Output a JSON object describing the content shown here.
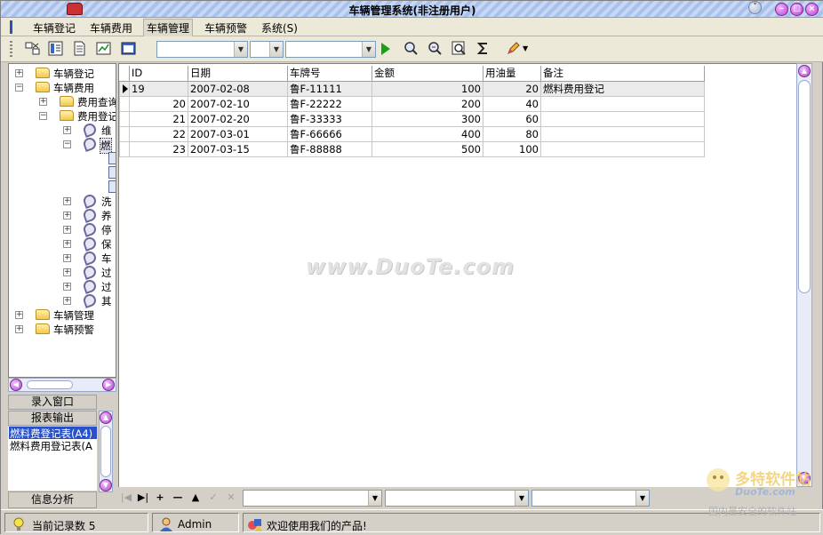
{
  "window": {
    "title": "车辆管理系统(非注册用户)"
  },
  "menu": {
    "items": [
      "车辆登记",
      "车辆费用",
      "车辆管理",
      "车辆预警",
      "系统(S)"
    ]
  },
  "toolbar": {
    "combo1": "",
    "combo2": "",
    "combo3": ""
  },
  "tree": {
    "nodes": [
      {
        "label": "车辆登记"
      },
      {
        "label": "车辆费用"
      },
      {
        "label": "费用查询"
      },
      {
        "label": "费用登记"
      },
      {
        "label": "维"
      },
      {
        "label": "燃"
      },
      {
        "label": "洗"
      },
      {
        "label": "养"
      },
      {
        "label": "停"
      },
      {
        "label": "保"
      },
      {
        "label": "车"
      },
      {
        "label": "过"
      },
      {
        "label": "过"
      },
      {
        "label": "其"
      },
      {
        "label": "车辆管理"
      },
      {
        "label": "车辆预警"
      }
    ]
  },
  "left_sections": {
    "entry_window": "录入窗口",
    "report_output": "报表输出",
    "reports": [
      "燃料费登记表(A4)",
      "燃料费用登记表(A"
    ],
    "analysis": "信息分析"
  },
  "grid": {
    "columns": [
      "ID",
      "日期",
      "车牌号",
      "金额",
      "用油量",
      "备注"
    ],
    "rows": [
      {
        "id": "19",
        "date": "2007-02-08",
        "plate": "鲁F-11111",
        "amount": "100",
        "fuel": "20",
        "note": "燃料费用登记"
      },
      {
        "id": "20",
        "date": "2007-02-10",
        "plate": "鲁F-22222",
        "amount": "200",
        "fuel": "40",
        "note": ""
      },
      {
        "id": "21",
        "date": "2007-02-20",
        "plate": "鲁F-33333",
        "amount": "300",
        "fuel": "60",
        "note": ""
      },
      {
        "id": "22",
        "date": "2007-03-01",
        "plate": "鲁F-66666",
        "amount": "400",
        "fuel": "80",
        "note": ""
      },
      {
        "id": "23",
        "date": "2007-03-15",
        "plate": "鲁F-88888",
        "amount": "500",
        "fuel": "100",
        "note": ""
      }
    ]
  },
  "watermark": "www.DuoTe.com",
  "navigator": {
    "buttons": [
      "|◀",
      "▶|",
      "+",
      "—",
      "▲",
      "✓",
      "✕"
    ]
  },
  "status": {
    "record_count": "当前记录数 5",
    "user": "Admin",
    "welcome": "欢迎使用我们的产品!"
  },
  "corner_logo": {
    "brand": "多特软件站",
    "url": "DuoTe.com",
    "slogan": "国内最安全的软件站"
  },
  "colors": {
    "selection": "#2a52c8",
    "window_bg": "#d4d0c8",
    "title_stripe": "#a9c1ec",
    "scroll_button": "#b04ad0"
  }
}
